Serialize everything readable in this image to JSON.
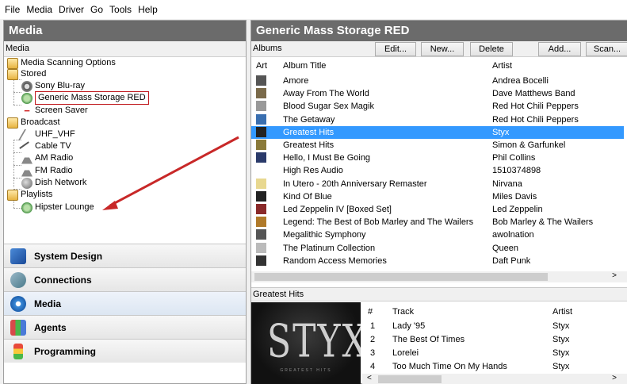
{
  "menu": [
    "File",
    "Media",
    "Driver",
    "Go",
    "Tools",
    "Help"
  ],
  "left_panel": {
    "title": "Media",
    "subheader": "Media",
    "tree": {
      "media_scanning": "Media Scanning Options",
      "stored": "Stored",
      "sony_bluray": "Sony Blu-ray",
      "generic_mass": "Generic Mass Storage RED",
      "screen_saver": "Screen Saver",
      "broadcast": "Broadcast",
      "uhf_vhf": "UHF_VHF",
      "cable_tv": "Cable TV",
      "am_radio": "AM Radio",
      "fm_radio": "FM Radio",
      "dish_network": "Dish Network",
      "playlists": "Playlists",
      "hipster_lounge": "Hipster Lounge"
    },
    "splitter_grip": "•••••••••",
    "nav": {
      "system_design": "System Design",
      "connections": "Connections",
      "media": "Media",
      "agents": "Agents",
      "programming": "Programming"
    }
  },
  "right_panel": {
    "title": "Generic Mass Storage RED",
    "albums_label": "Albums",
    "buttons": {
      "edit": "Edit...",
      "new": "New...",
      "delete": "Delete",
      "add": "Add...",
      "scan": "Scan..."
    },
    "columns": {
      "art": "Art",
      "album_title": "Album Title",
      "artist": "Artist"
    },
    "albums": [
      {
        "title": "Amore",
        "artist": "Andrea Bocelli"
      },
      {
        "title": "Away From The World",
        "artist": "Dave Matthews Band"
      },
      {
        "title": "Blood Sugar Sex Magik",
        "artist": "Red Hot Chili Peppers"
      },
      {
        "title": "The Getaway",
        "artist": "Red Hot Chili Peppers"
      },
      {
        "title": "Greatest Hits",
        "artist": "Styx"
      },
      {
        "title": "Greatest Hits",
        "artist": "Simon & Garfunkel"
      },
      {
        "title": "Hello, I Must Be Going",
        "artist": "Phil Collins"
      },
      {
        "title": "High Res Audio",
        "artist": "1510374898"
      },
      {
        "title": "In Utero - 20th Anniversary Remaster",
        "artist": "Nirvana"
      },
      {
        "title": "Kind Of Blue",
        "artist": "Miles Davis"
      },
      {
        "title": "Led Zeppelin IV [Boxed Set]",
        "artist": "Led Zeppelin"
      },
      {
        "title": "Legend: The Best of Bob Marley and The Wailers",
        "artist": "Bob Marley & The Wailers"
      },
      {
        "title": "Megalithic Symphony",
        "artist": "awolnation"
      },
      {
        "title": "The Platinum Collection",
        "artist": "Queen"
      },
      {
        "title": "Random Access Memories",
        "artist": "Daft Punk"
      }
    ],
    "selected_index": 4,
    "thumb_colors": [
      "#555",
      "#7a6a4a",
      "#999",
      "#3a6fb0",
      "#222",
      "#8a7a3a",
      "#2a3a6a",
      "#fff",
      "#e8d890",
      "#222",
      "#8a2a2a",
      "#b07a2a",
      "#555",
      "#bbb",
      "#333"
    ],
    "detail": {
      "title": "Greatest Hits",
      "cover_logo": "STYX",
      "cover_sub": "GREATEST HITS",
      "columns": {
        "num": "#",
        "track": "Track",
        "artist": "Artist"
      },
      "tracks": [
        {
          "num": "1",
          "track": "Lady '95",
          "artist": "Styx"
        },
        {
          "num": "2",
          "track": "The Best Of Times",
          "artist": "Styx"
        },
        {
          "num": "3",
          "track": "Lorelei",
          "artist": "Styx"
        },
        {
          "num": "4",
          "track": "Too Much Time On My Hands",
          "artist": "Styx"
        }
      ]
    },
    "scroll_left": "<",
    "scroll_right": ">"
  },
  "colors": {
    "header_bg": "#6b6b6b",
    "selection": "#3399ff",
    "highlight_box": "#c0181d",
    "arrow": "#c82828"
  }
}
